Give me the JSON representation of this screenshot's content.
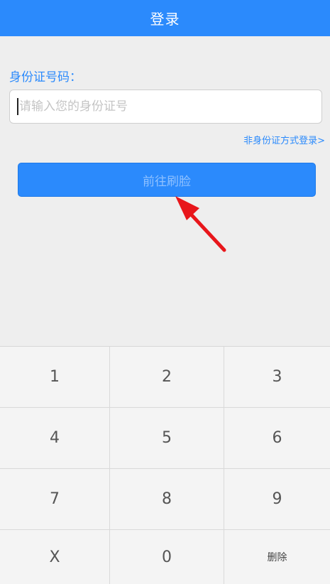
{
  "header": {
    "title": "登录"
  },
  "form": {
    "id_label": "身份证号码：",
    "id_placeholder": "请输入您的身份证号",
    "id_value": "",
    "alt_login_link": "非身份证方式登录>",
    "submit_label": "前往刷脸"
  },
  "keypad": {
    "keys": [
      "1",
      "2",
      "3",
      "4",
      "5",
      "6",
      "7",
      "8",
      "9",
      "X",
      "0",
      "删除"
    ]
  },
  "colors": {
    "accent": "#2b8afc",
    "annotation_arrow": "#e8161b"
  }
}
